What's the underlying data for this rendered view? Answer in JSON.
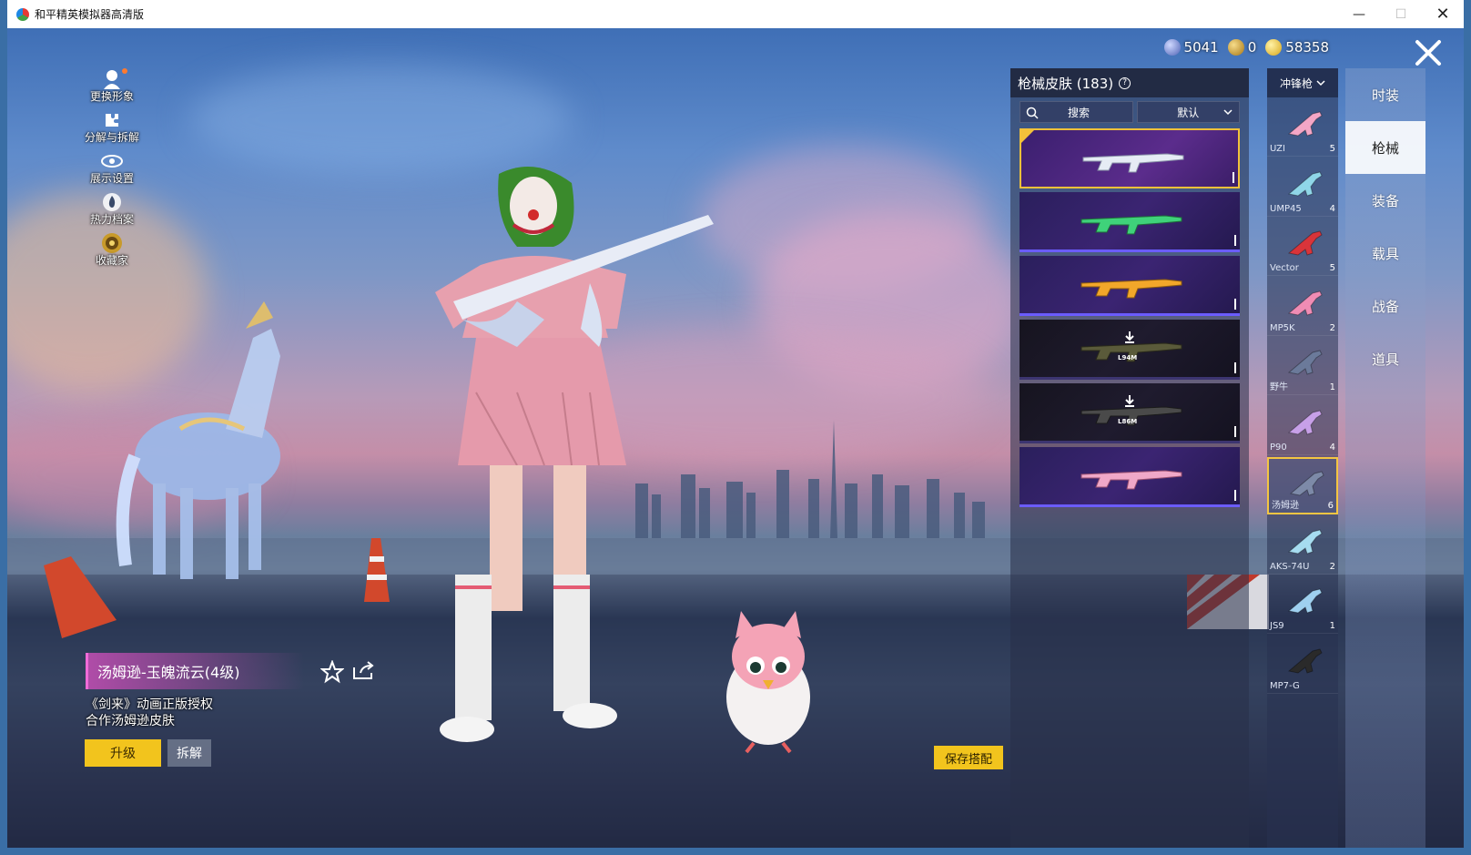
{
  "window": {
    "title": "和平精英模拟器高清版",
    "min": "—",
    "max": "☐",
    "close": "✕"
  },
  "left_menu": [
    {
      "label": "更换形象",
      "icon": "person-icon"
    },
    {
      "label": "分解与拆解",
      "icon": "puzzle-icon"
    },
    {
      "label": "展示设置",
      "icon": "eye-icon"
    },
    {
      "label": "热力档案",
      "icon": "flame-icon"
    },
    {
      "label": "收藏家",
      "icon": "collector-icon"
    }
  ],
  "currency": [
    {
      "value": "5041",
      "icon": "globe-coin-icon",
      "color": "#5b77c9"
    },
    {
      "value": "0",
      "icon": "triangle-coin-icon",
      "color": "#d4a020"
    },
    {
      "value": "58358",
      "icon": "gold-coin-icon",
      "color": "#e8c12c"
    }
  ],
  "right_nav": [
    {
      "label": "时装",
      "active": false
    },
    {
      "label": "枪械",
      "active": true
    },
    {
      "label": "装备",
      "active": false
    },
    {
      "label": "载具",
      "active": false
    },
    {
      "label": "战备",
      "active": false
    },
    {
      "label": "道具",
      "active": false
    }
  ],
  "weapon_filter": {
    "label": "冲锋枪"
  },
  "weapons": [
    {
      "name": "UZI",
      "count": "5",
      "color": "#f4a6c6"
    },
    {
      "name": "UMP45",
      "count": "4",
      "color": "#8fd6e8"
    },
    {
      "name": "Vector",
      "count": "5",
      "color": "#d9343a"
    },
    {
      "name": "MP5K",
      "count": "2",
      "color": "#f08cb4"
    },
    {
      "name": "野牛",
      "count": "1",
      "color": "#6b7a9a"
    },
    {
      "name": "P90",
      "count": "4",
      "color": "#c7a0e8"
    },
    {
      "name": "汤姆逊",
      "count": "6",
      "color": "#7d8aa8",
      "selected": true
    },
    {
      "name": "AKS-74U",
      "count": "2",
      "color": "#a6dcf0"
    },
    {
      "name": "JS9",
      "count": "1",
      "color": "#9fd0f0"
    },
    {
      "name": "MP7-G",
      "count": "",
      "color": "#2a2a2a"
    }
  ],
  "skin_panel": {
    "title": "枪械皮肤 (183)",
    "search": "搜索",
    "sort": "默认",
    "cards": [
      {
        "style": "gold",
        "gun_color": "#dfe6ef",
        "equipped": true
      },
      {
        "style": "purple",
        "gun_color": "#3fd27a"
      },
      {
        "style": "purple",
        "gun_color": "#f2a72a"
      },
      {
        "style": "dark",
        "gun_color": "#5a5a3a",
        "label": "L94M"
      },
      {
        "style": "dark",
        "gun_color": "#4a4a4a",
        "label": "L86M"
      },
      {
        "style": "purple",
        "gun_color": "#f0a8c8"
      }
    ]
  },
  "item_info": {
    "title": "汤姆逊-玉魄流云(4级)",
    "desc_line1": "《剑来》动画正版授权",
    "desc_line2": "合作汤姆逊皮肤"
  },
  "buttons": {
    "upgrade": "升级",
    "dismantle": "拆解",
    "save": "保存搭配"
  }
}
